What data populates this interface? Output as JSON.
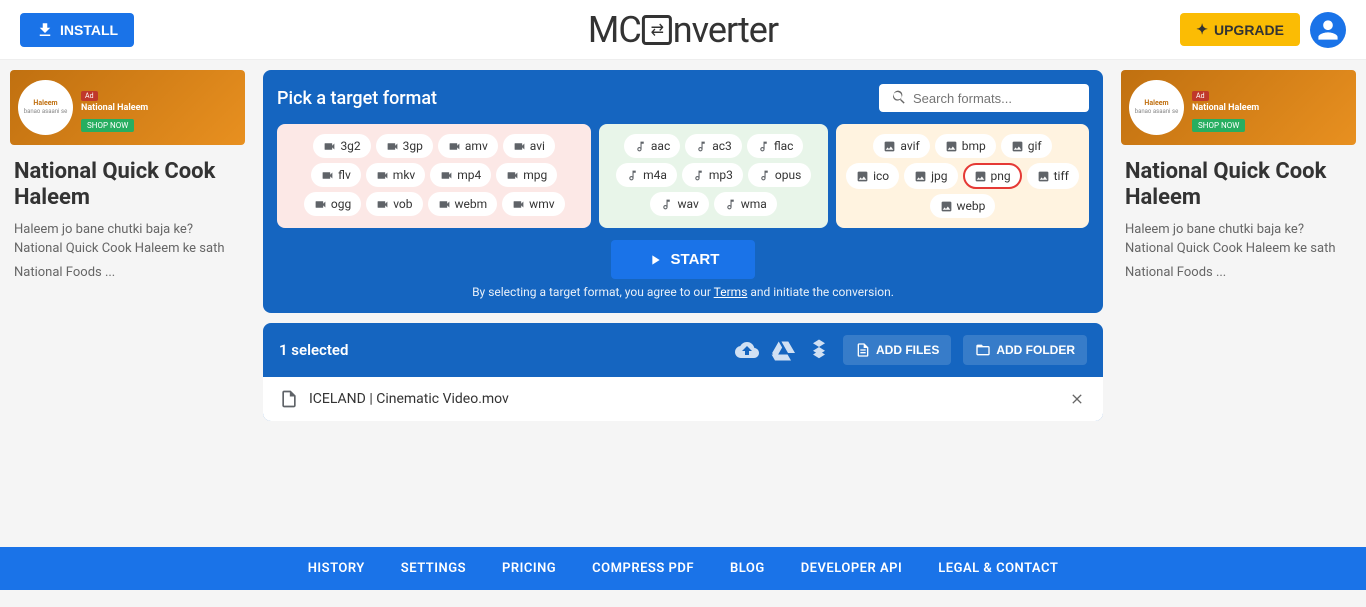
{
  "header": {
    "install_label": "INSTALL",
    "logo_prefix": "MC",
    "logo_icon": "⇄",
    "logo_suffix": "nverter",
    "upgrade_label": "✦ UPGRADE"
  },
  "format_picker": {
    "title": "Pick a target format",
    "search_placeholder": "Search formats...",
    "start_label": "START",
    "terms_text": "By selecting a target format, you agree to our",
    "terms_link": "Terms",
    "terms_suffix": "and initiate the conversion."
  },
  "video_formats": [
    "3g2",
    "3gp",
    "amv",
    "avi",
    "flv",
    "mkv",
    "mp4",
    "mpg",
    "ogg",
    "vob",
    "webm",
    "wmv"
  ],
  "audio_formats": [
    "aac",
    "ac3",
    "flac",
    "m4a",
    "mp3",
    "opus",
    "wav",
    "wma"
  ],
  "image_formats": [
    "avif",
    "bmp",
    "gif",
    "ico",
    "jpg",
    "png",
    "tiff",
    "webp"
  ],
  "selected_format": "png",
  "file_section": {
    "selected_count": "1 selected",
    "add_files_label": "ADD FILES",
    "add_folder_label": "ADD FOLDER",
    "file_name": "ICELAND | Cinematic Video.mov"
  },
  "footer": {
    "links": [
      "HISTORY",
      "SETTINGS",
      "PRICING",
      "COMPRESS PDF",
      "BLOG",
      "DEVELOPER API",
      "LEGAL & CONTACT"
    ]
  },
  "sidebar_left": {
    "ad_title": "National Quick Cook Haleem",
    "ad_desc": "Haleem jo bane chutki baja ke? National Quick Cook Haleem ke sath",
    "ad_more": "National Foods ..."
  },
  "sidebar_right": {
    "ad_title": "National Quick Cook Haleem",
    "ad_desc": "Haleem jo bane chutki baja ke? National Quick Cook Haleem ke sath",
    "ad_more": "National Foods ..."
  }
}
